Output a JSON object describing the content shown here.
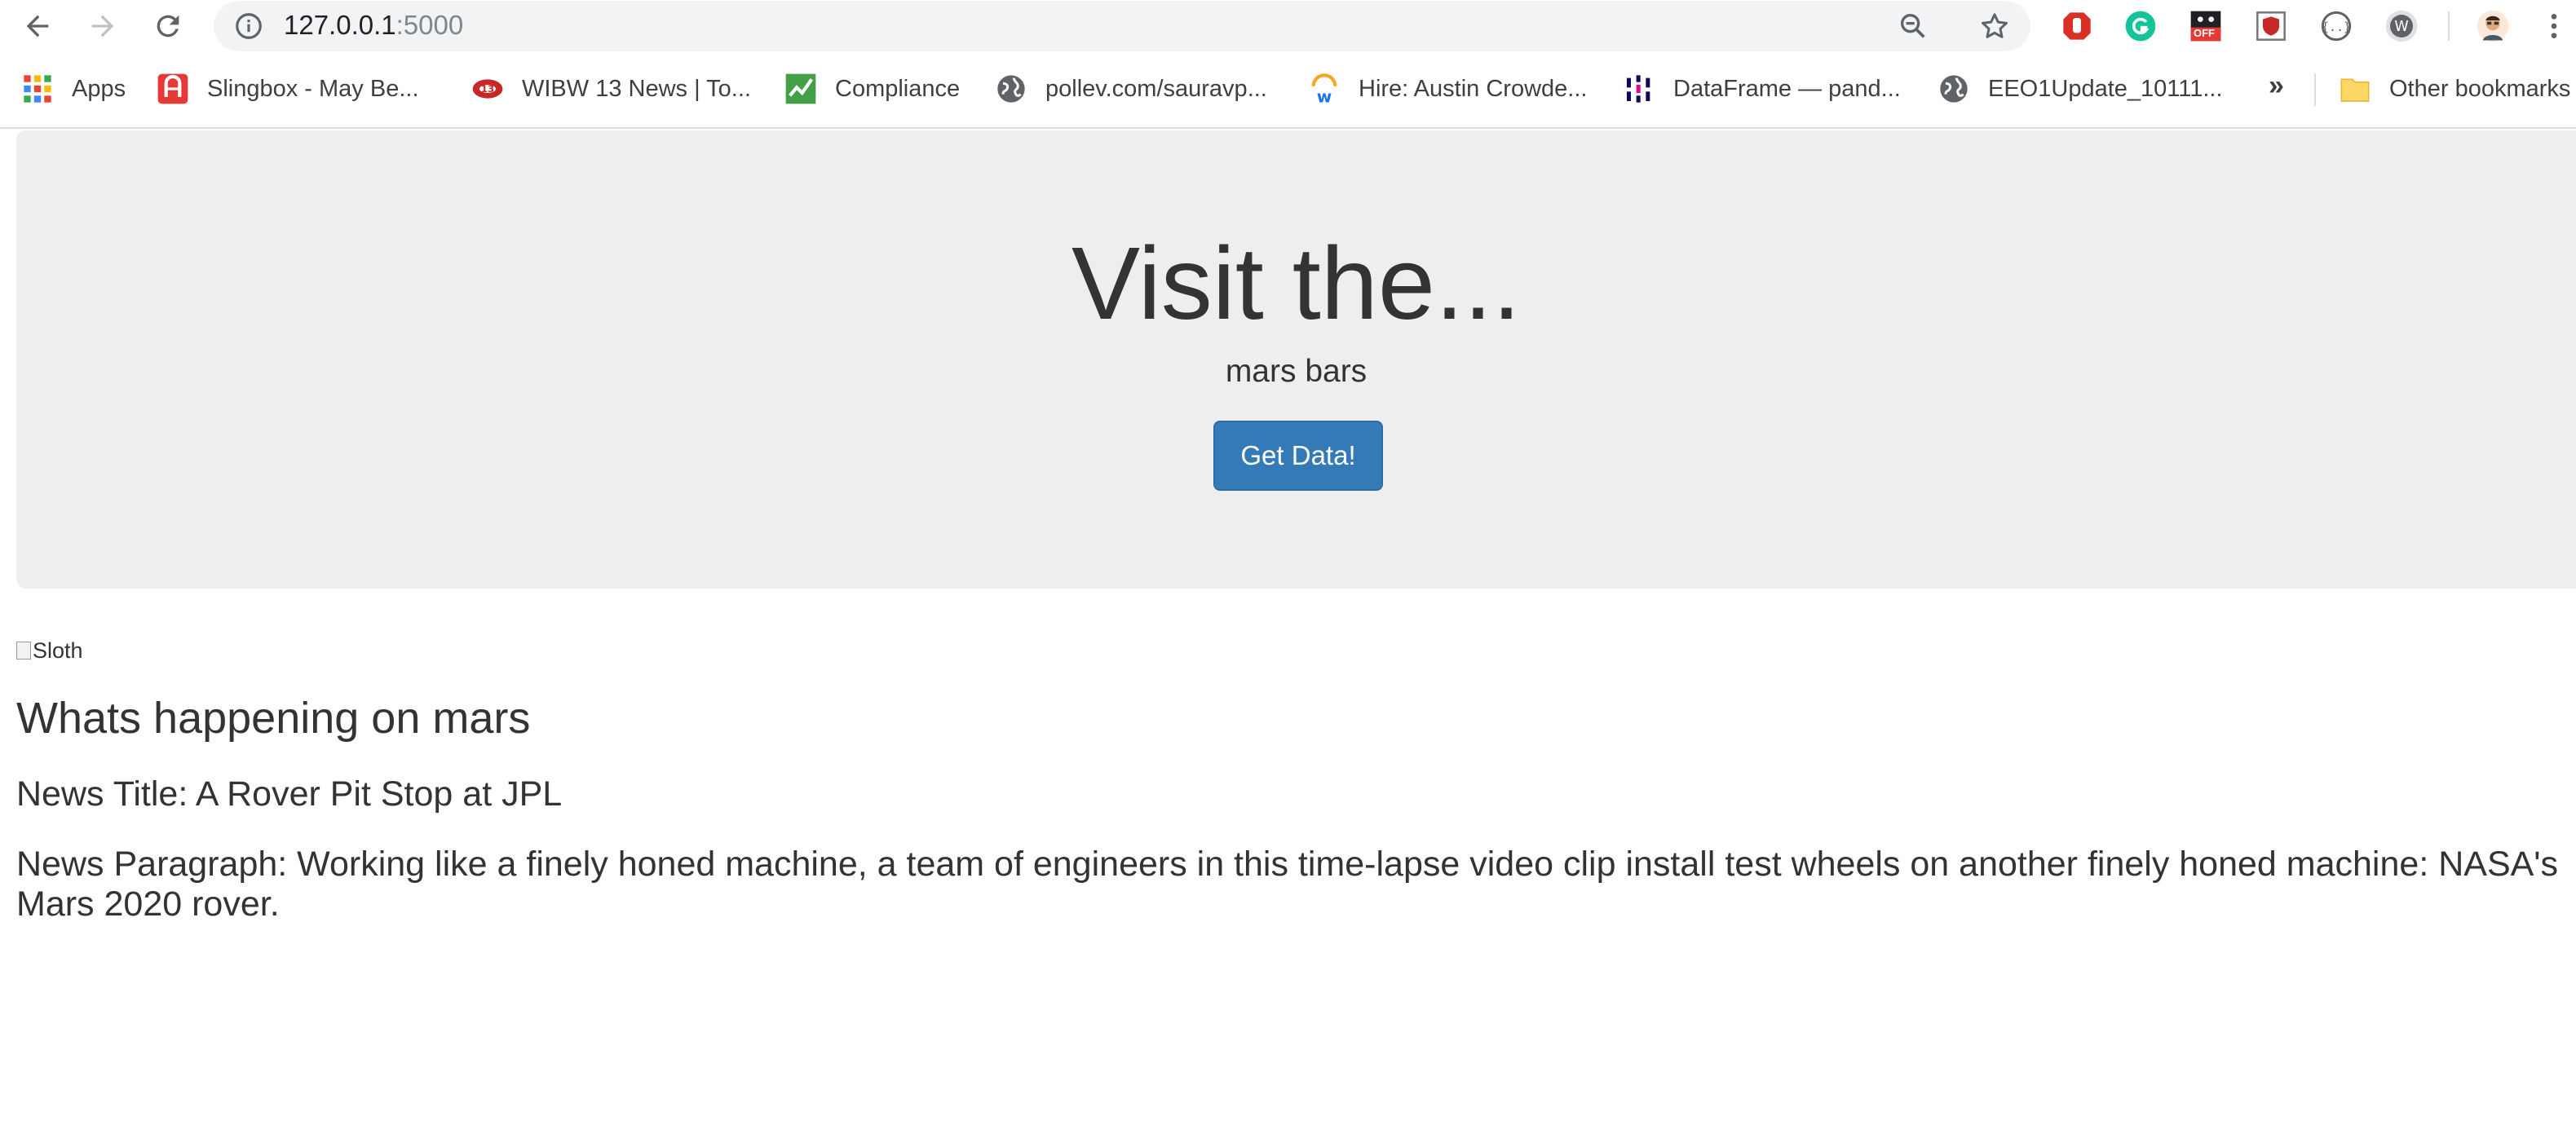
{
  "browser": {
    "url_host": "127.0.0.1",
    "url_port": ":5000"
  },
  "bookmarks": [
    {
      "label": "Apps",
      "icon": "apps-grid-icon"
    },
    {
      "label": "Slingbox - May Be...",
      "icon": "slingbox-icon"
    },
    {
      "label": "WIBW 13 News | To...",
      "icon": "wibw-icon"
    },
    {
      "label": "Compliance",
      "icon": "compliance-check-icon"
    },
    {
      "label": "pollev.com/sauravp...",
      "icon": "globe-icon"
    },
    {
      "label": "Hire: Austin Crowde...",
      "icon": "workday-icon"
    },
    {
      "label": "DataFrame — pand...",
      "icon": "pandas-icon"
    },
    {
      "label": "EEO1Update_10111...",
      "icon": "globe-icon"
    }
  ],
  "bookmarks_overflow": "»",
  "other_bookmarks": "Other bookmarks",
  "extensions": {
    "offer_badge": "OFF"
  },
  "jumbotron": {
    "title": "Visit the...",
    "subtitle": "mars bars",
    "button_label": "Get Data!"
  },
  "image": {
    "alt": "Sloth"
  },
  "content": {
    "heading": "Whats happening on mars",
    "news_title": "News Title: A Rover Pit Stop at JPL",
    "news_paragraph": "News Paragraph: Working like a finely honed machine, a team of engineers in this time-lapse video clip install test wheels on another finely honed machine: NASA's Mars 2020 rover."
  },
  "colors": {
    "button_primary": "#337ab7",
    "jumbotron_bg": "#eeeeee",
    "text": "#333333"
  }
}
